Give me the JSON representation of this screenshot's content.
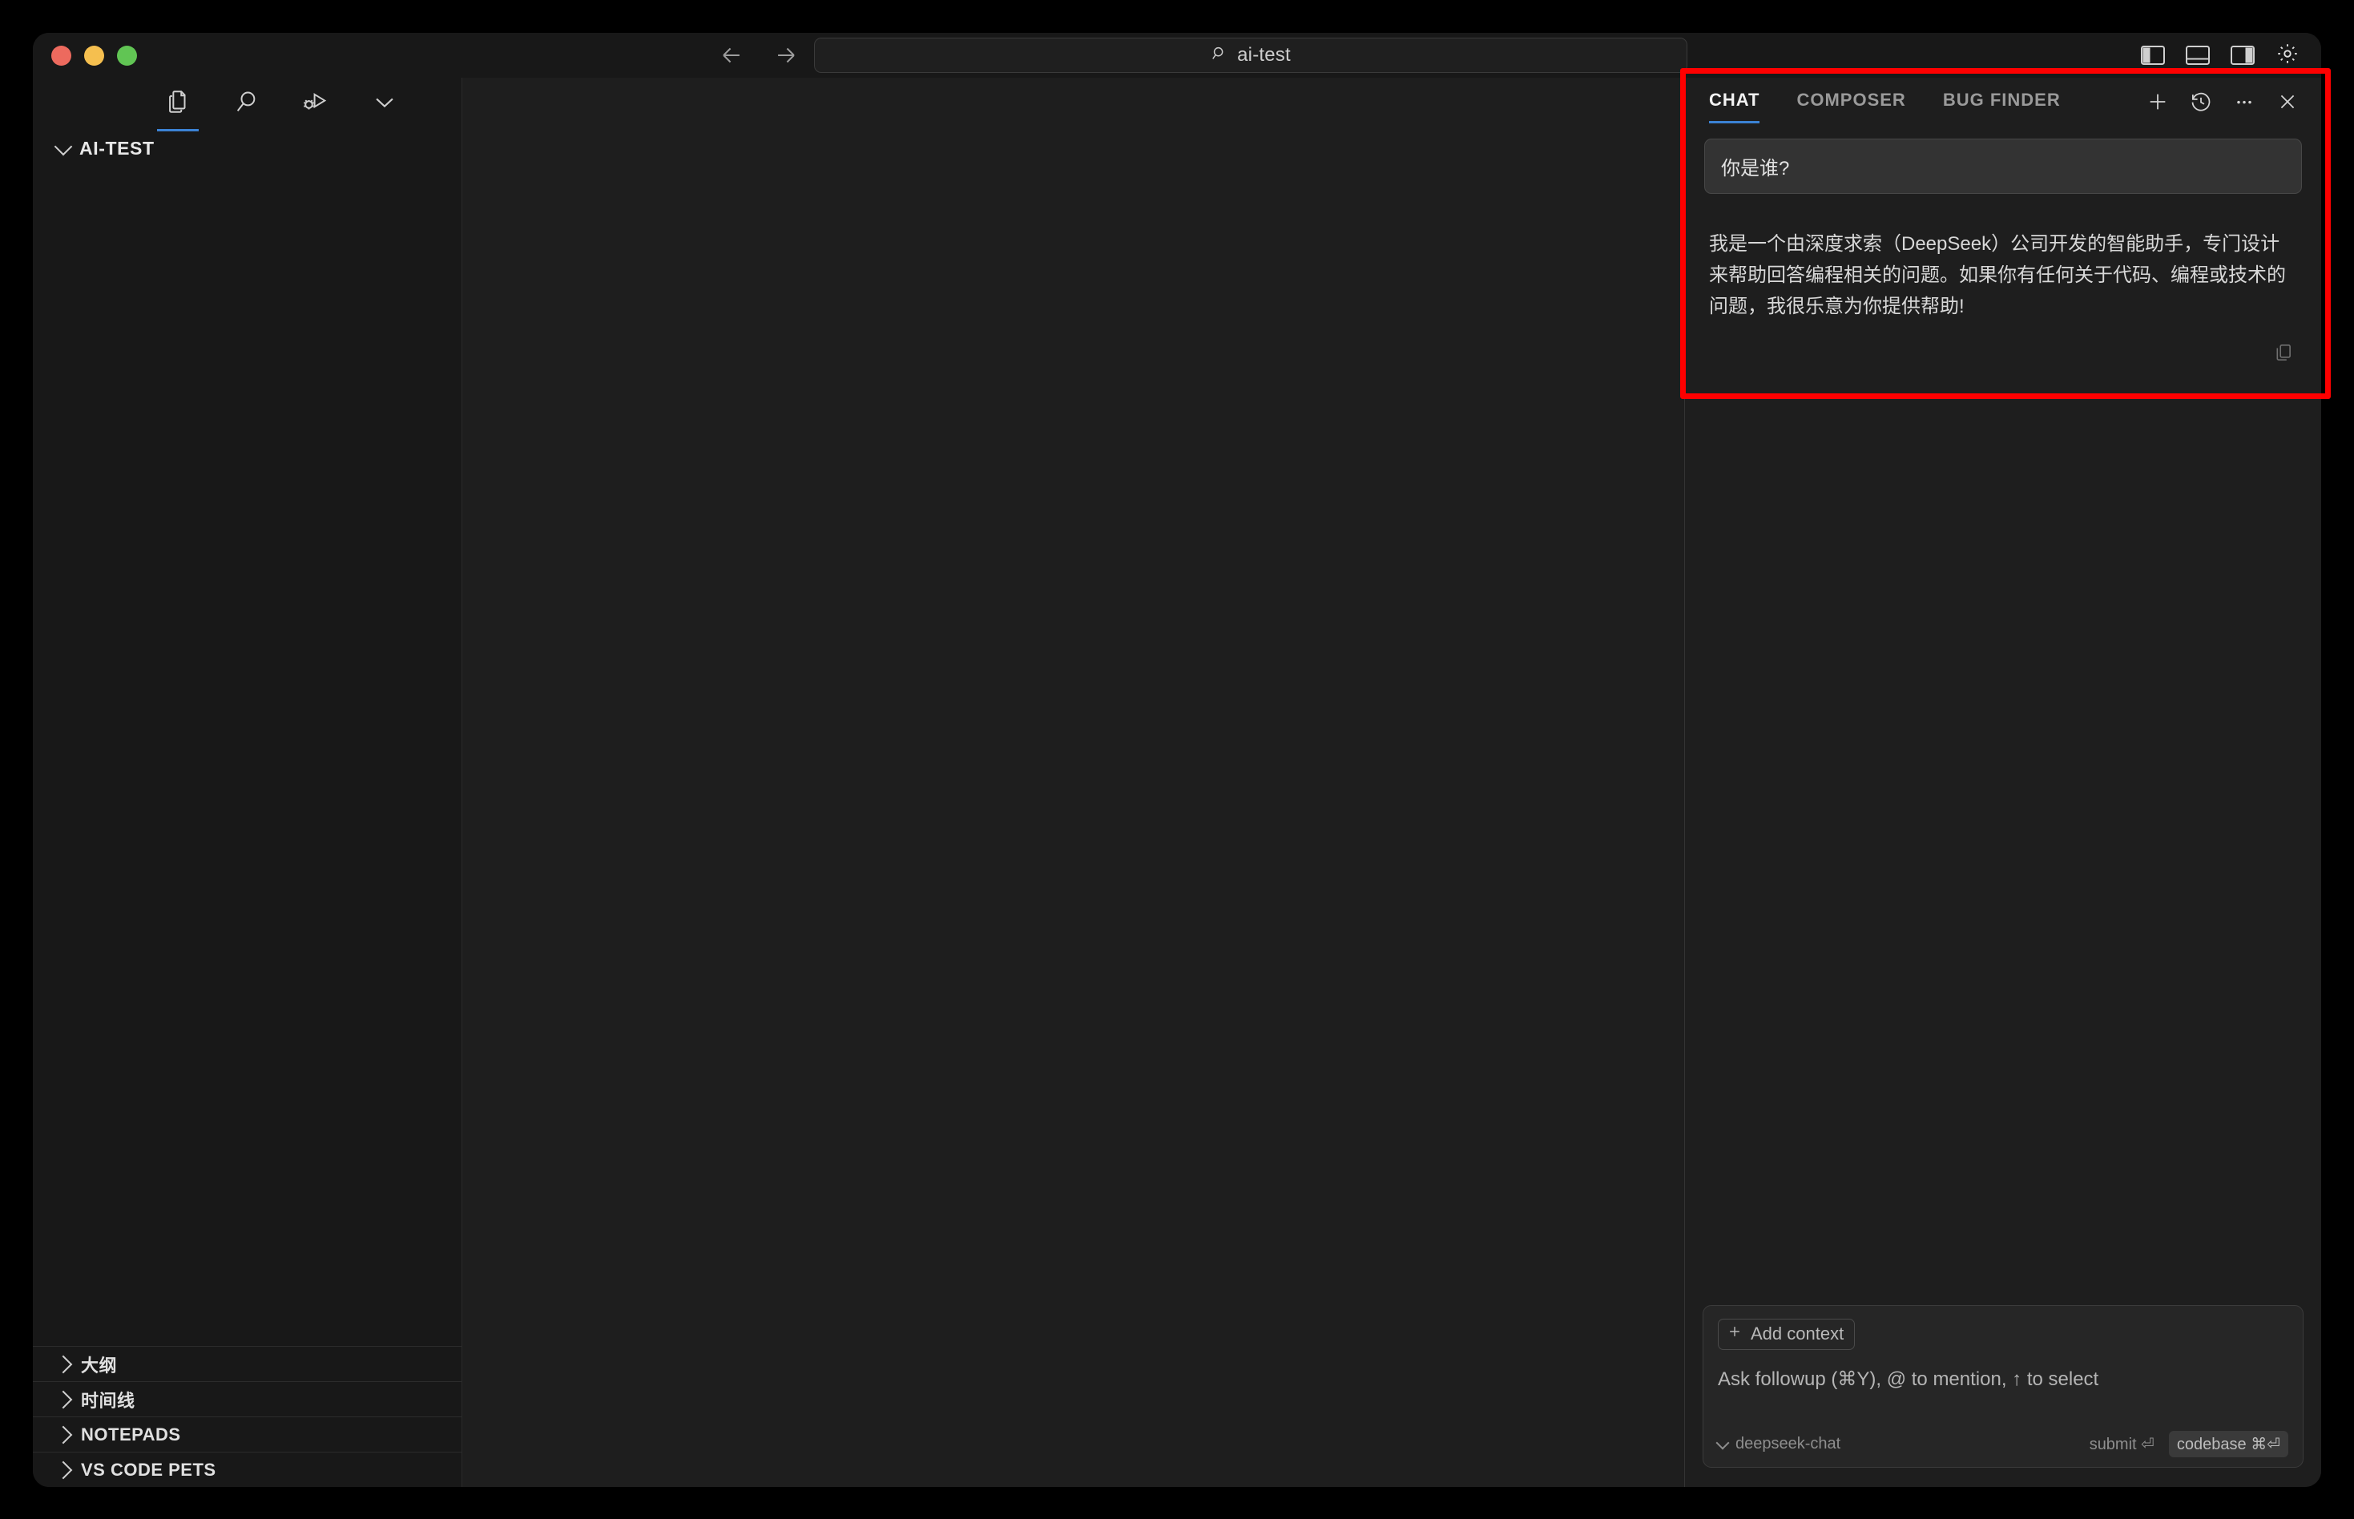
{
  "window": {
    "traffic_lights": [
      "close",
      "minimize",
      "maximize"
    ]
  },
  "titlebar": {
    "back_icon": "arrow-left-icon",
    "forward_icon": "arrow-right-icon",
    "search": {
      "icon": "search-icon",
      "value": "ai-test",
      "placeholder": "Search"
    },
    "layout_toggles": [
      {
        "name": "toggle-primary-sidebar",
        "icon": "panel-left-icon"
      },
      {
        "name": "toggle-panel",
        "icon": "panel-bottom-icon"
      },
      {
        "name": "toggle-secondary-sidebar",
        "icon": "panel-right-icon"
      }
    ],
    "settings_icon": "gear-icon"
  },
  "sidebar": {
    "tools": [
      {
        "name": "explorer",
        "icon": "files-icon",
        "active": true
      },
      {
        "name": "search",
        "icon": "search-icon",
        "active": false
      },
      {
        "name": "run-and-debug",
        "icon": "debug-icon",
        "active": false
      },
      {
        "name": "more-views",
        "icon": "chevron-down-icon",
        "active": false
      }
    ],
    "workspace": {
      "label": "AI-TEST",
      "expanded": true
    },
    "sections": [
      {
        "label": "大纲",
        "expanded": false
      },
      {
        "label": "时间线",
        "expanded": false
      },
      {
        "label": "NOTEPADS",
        "expanded": false
      },
      {
        "label": "VS CODE PETS",
        "expanded": false
      }
    ]
  },
  "chat": {
    "tabs": [
      {
        "label": "CHAT",
        "active": true
      },
      {
        "label": "COMPOSER",
        "active": false
      },
      {
        "label": "BUG FINDER",
        "active": false
      }
    ],
    "actions": [
      {
        "name": "new-chat-button",
        "icon": "plus-icon"
      },
      {
        "name": "chat-history-button",
        "icon": "history-icon"
      },
      {
        "name": "more-options-button",
        "icon": "ellipsis-icon"
      },
      {
        "name": "close-panel-button",
        "icon": "close-icon"
      }
    ],
    "messages": {
      "user": "你是谁?",
      "assistant": "我是一个由深度求索（DeepSeek）公司开发的智能助手，专门设计来帮助回答编程相关的问题。如果你有任何关于代码、编程或技术的问题，我很乐意为你提供帮助!",
      "copy_icon": "copy-icon"
    },
    "composer": {
      "add_context_label": "Add context",
      "add_context_icon": "plus-icon",
      "placeholder": "Ask followup (⌘Y), @ to mention, ↑ to select",
      "model": "deepseek-chat",
      "model_chevron_icon": "chevron-down-icon",
      "submit_label": "submit",
      "submit_key": "⏎",
      "codebase_label": "codebase",
      "codebase_key": "⌘⏎"
    }
  },
  "annotation": {
    "color": "#fe0000",
    "target": "chat-conversation-area"
  }
}
